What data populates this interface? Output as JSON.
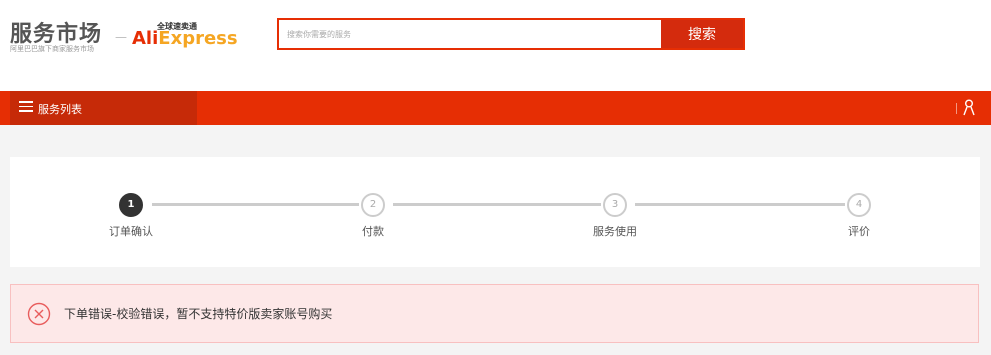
{
  "logo": {
    "main_text": "服务市场",
    "sub_text": "阿里巴巴旗下商家服务市场",
    "separator": "—",
    "partner_tag": "全球速卖通",
    "partner_name_red": "Ali",
    "partner_name_orange": "Express"
  },
  "search": {
    "placeholder": "搜索你需要的服务",
    "button_label": "搜索"
  },
  "nav": {
    "tab_label": "服务列表",
    "menu_icon": "menu-icon",
    "user_icon": "user-icon"
  },
  "steps": [
    {
      "number": "1",
      "label": "订单确认",
      "active": true
    },
    {
      "number": "2",
      "label": "付款",
      "active": false
    },
    {
      "number": "3",
      "label": "服务使用",
      "active": false
    },
    {
      "number": "4",
      "label": "评价",
      "active": false
    }
  ],
  "error": {
    "icon": "close-circle-icon",
    "message": "下单错误-校验错误，暂不支持特价版卖家账号购买"
  },
  "colors": {
    "brand_red": "#e62e04",
    "nav_tab_dark": "#c62a08",
    "search_button": "#d42b0d",
    "error_bg": "#fde8e8",
    "error_icon": "#e85c5c",
    "step_active": "#333333",
    "step_inactive": "#cccccc"
  }
}
